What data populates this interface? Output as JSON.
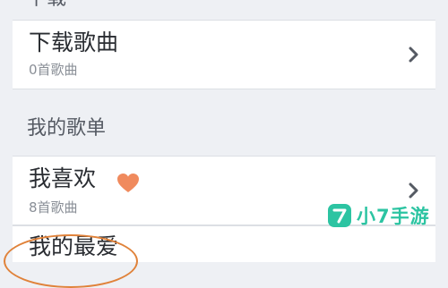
{
  "top_section": {
    "header": "下载"
  },
  "download_card": {
    "title": "下载歌曲",
    "subtitle": "0首歌曲",
    "chevron_icon": "chevron-right-icon"
  },
  "playlists_section": {
    "header": "我的歌单"
  },
  "favorites_card": {
    "title": "我喜欢",
    "subtitle": "8首歌曲",
    "heart_icon": "heart-icon",
    "heart_color": "#f08a5d",
    "chevron_icon": "chevron-right-icon"
  },
  "partial_card": {
    "title": "我的最爱"
  },
  "annotation": {
    "color": "#e0823a"
  },
  "watermark": {
    "text": "小7手游",
    "color": "#2cc4a2"
  }
}
